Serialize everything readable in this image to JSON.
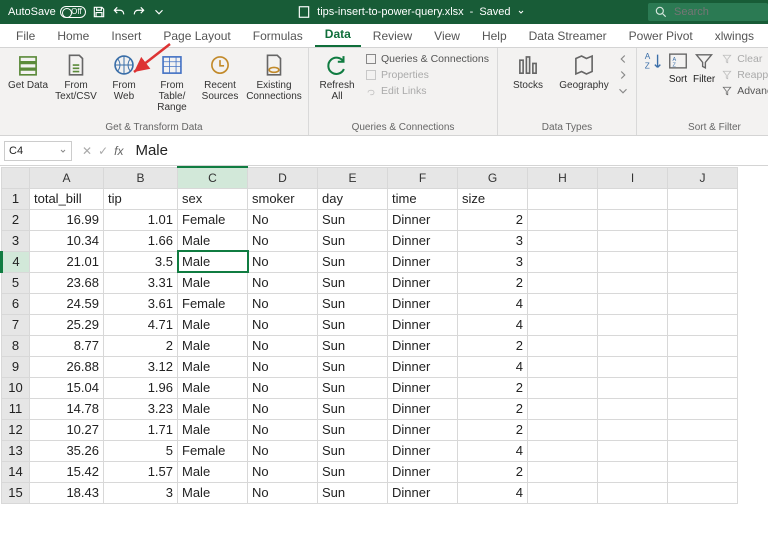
{
  "titlebar": {
    "autosave_label": "AutoSave",
    "autosave_state": "Off",
    "filename": "tips-insert-to-power-query.xlsx",
    "save_status": "Saved",
    "search_placeholder": "Search"
  },
  "tabs": [
    "File",
    "Home",
    "Insert",
    "Page Layout",
    "Formulas",
    "Data",
    "Review",
    "View",
    "Help",
    "Data Streamer",
    "Power Pivot",
    "xlwings"
  ],
  "active_tab": "Data",
  "ribbon": {
    "get_transform": {
      "get_data": "Get\nData",
      "from_textcsv": "From\nText/CSV",
      "from_web": "From\nWeb",
      "from_table": "From Table/\nRange",
      "recent_sources": "Recent\nSources",
      "existing_conn": "Existing\nConnections",
      "label": "Get & Transform Data"
    },
    "queries": {
      "refresh_all": "Refresh\nAll",
      "queries_conn": "Queries & Connections",
      "properties": "Properties",
      "edit_links": "Edit Links",
      "label": "Queries & Connections"
    },
    "datatypes": {
      "stocks": "Stocks",
      "geography": "Geography",
      "label": "Data Types"
    },
    "sortfilter": {
      "sort": "Sort",
      "filter": "Filter",
      "clear": "Clear",
      "reapply": "Reapply",
      "advanced": "Advanced",
      "label": "Sort & Filter"
    }
  },
  "namebox": "C4",
  "formula": "Male",
  "columns": [
    "A",
    "B",
    "C",
    "D",
    "E",
    "F",
    "G",
    "H",
    "I",
    "J"
  ],
  "active_col": "C",
  "active_row": 4,
  "headers": [
    "total_bill",
    "tip",
    "sex",
    "smoker",
    "day",
    "time",
    "size"
  ],
  "rows": [
    {
      "total_bill": "16.99",
      "tip": "1.01",
      "sex": "Female",
      "smoker": "No",
      "day": "Sun",
      "time": "Dinner",
      "size": "2"
    },
    {
      "total_bill": "10.34",
      "tip": "1.66",
      "sex": "Male",
      "smoker": "No",
      "day": "Sun",
      "time": "Dinner",
      "size": "3"
    },
    {
      "total_bill": "21.01",
      "tip": "3.5",
      "sex": "Male",
      "smoker": "No",
      "day": "Sun",
      "time": "Dinner",
      "size": "3"
    },
    {
      "total_bill": "23.68",
      "tip": "3.31",
      "sex": "Male",
      "smoker": "No",
      "day": "Sun",
      "time": "Dinner",
      "size": "2"
    },
    {
      "total_bill": "24.59",
      "tip": "3.61",
      "sex": "Female",
      "smoker": "No",
      "day": "Sun",
      "time": "Dinner",
      "size": "4"
    },
    {
      "total_bill": "25.29",
      "tip": "4.71",
      "sex": "Male",
      "smoker": "No",
      "day": "Sun",
      "time": "Dinner",
      "size": "4"
    },
    {
      "total_bill": "8.77",
      "tip": "2",
      "sex": "Male",
      "smoker": "No",
      "day": "Sun",
      "time": "Dinner",
      "size": "2"
    },
    {
      "total_bill": "26.88",
      "tip": "3.12",
      "sex": "Male",
      "smoker": "No",
      "day": "Sun",
      "time": "Dinner",
      "size": "4"
    },
    {
      "total_bill": "15.04",
      "tip": "1.96",
      "sex": "Male",
      "smoker": "No",
      "day": "Sun",
      "time": "Dinner",
      "size": "2"
    },
    {
      "total_bill": "14.78",
      "tip": "3.23",
      "sex": "Male",
      "smoker": "No",
      "day": "Sun",
      "time": "Dinner",
      "size": "2"
    },
    {
      "total_bill": "10.27",
      "tip": "1.71",
      "sex": "Male",
      "smoker": "No",
      "day": "Sun",
      "time": "Dinner",
      "size": "2"
    },
    {
      "total_bill": "35.26",
      "tip": "5",
      "sex": "Female",
      "smoker": "No",
      "day": "Sun",
      "time": "Dinner",
      "size": "4"
    },
    {
      "total_bill": "15.42",
      "tip": "1.57",
      "sex": "Male",
      "smoker": "No",
      "day": "Sun",
      "time": "Dinner",
      "size": "2"
    },
    {
      "total_bill": "18.43",
      "tip": "3",
      "sex": "Male",
      "smoker": "No",
      "day": "Sun",
      "time": "Dinner",
      "size": "4"
    }
  ]
}
